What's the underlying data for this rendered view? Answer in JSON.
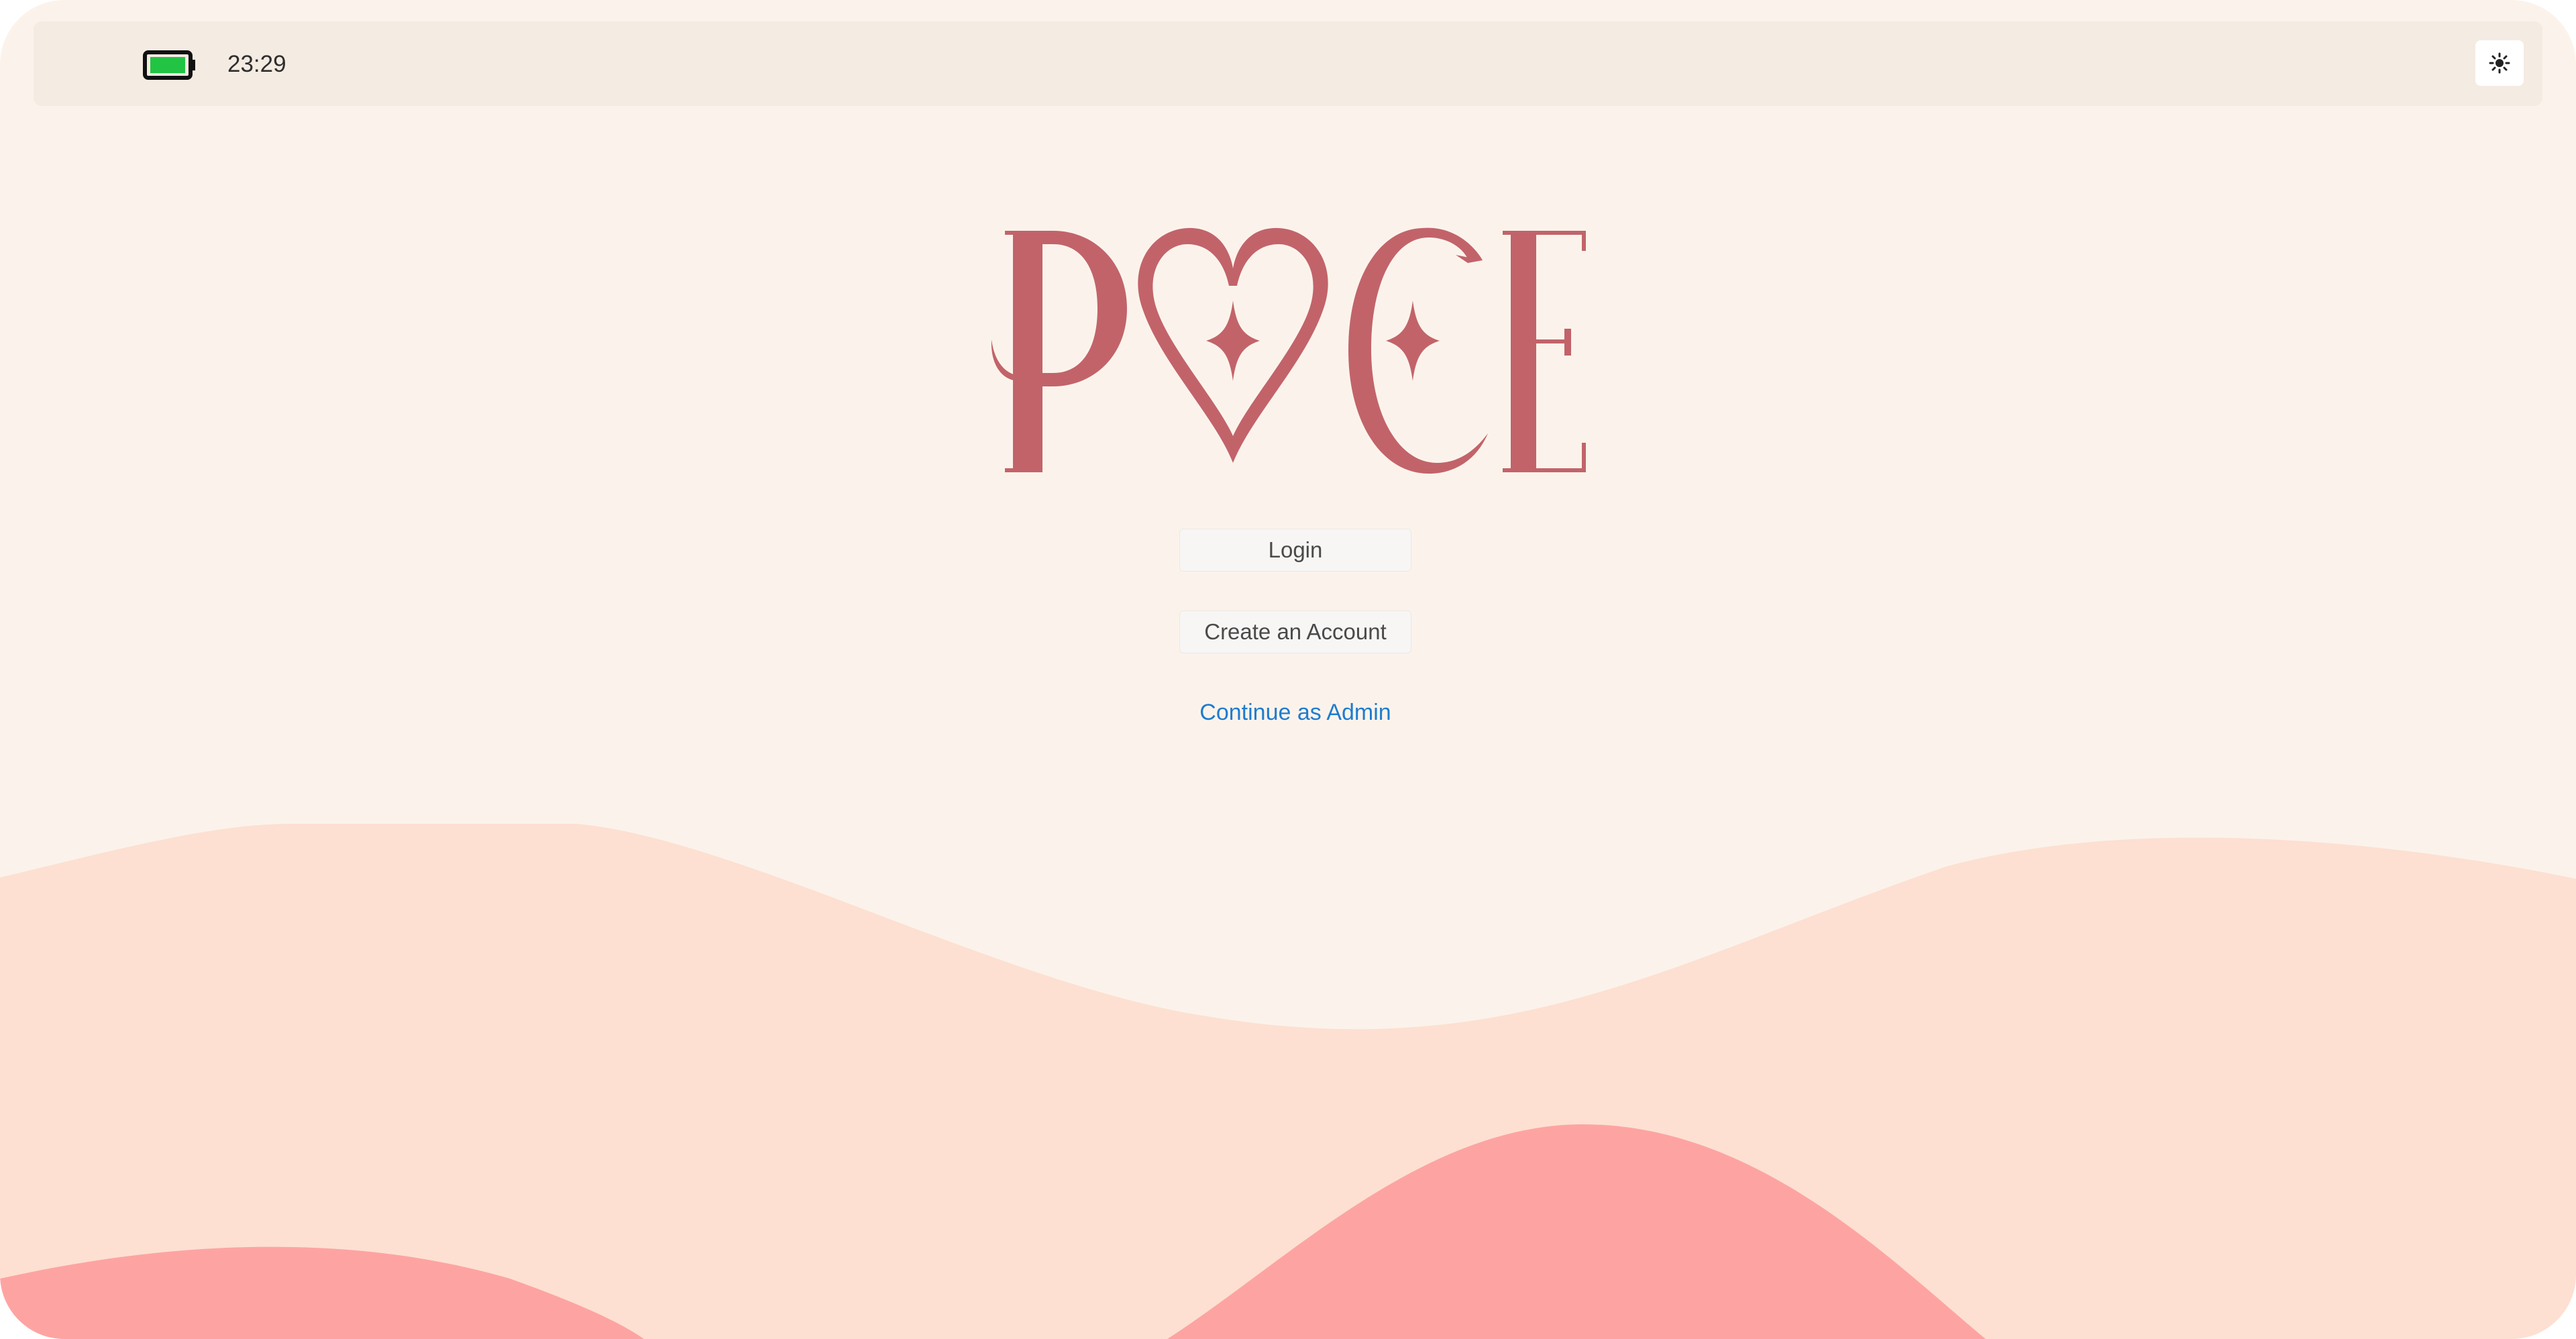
{
  "status_bar": {
    "time": "23:29",
    "battery_icon": "battery-full-icon",
    "battery_color": "#22c444",
    "theme_toggle_icon": "sun-icon"
  },
  "logo": {
    "wordmark": "PLACE",
    "color": "#c2636a"
  },
  "actions": {
    "login_label": "Login",
    "create_account_label": "Create an Account",
    "admin_link_label": "Continue as Admin"
  },
  "colors": {
    "background": "#fbf3eb",
    "status_bar": "#f4ebe2",
    "wave_light": "#fde0d2",
    "wave_dark": "#fda4a2",
    "link": "#1f7bcf"
  }
}
